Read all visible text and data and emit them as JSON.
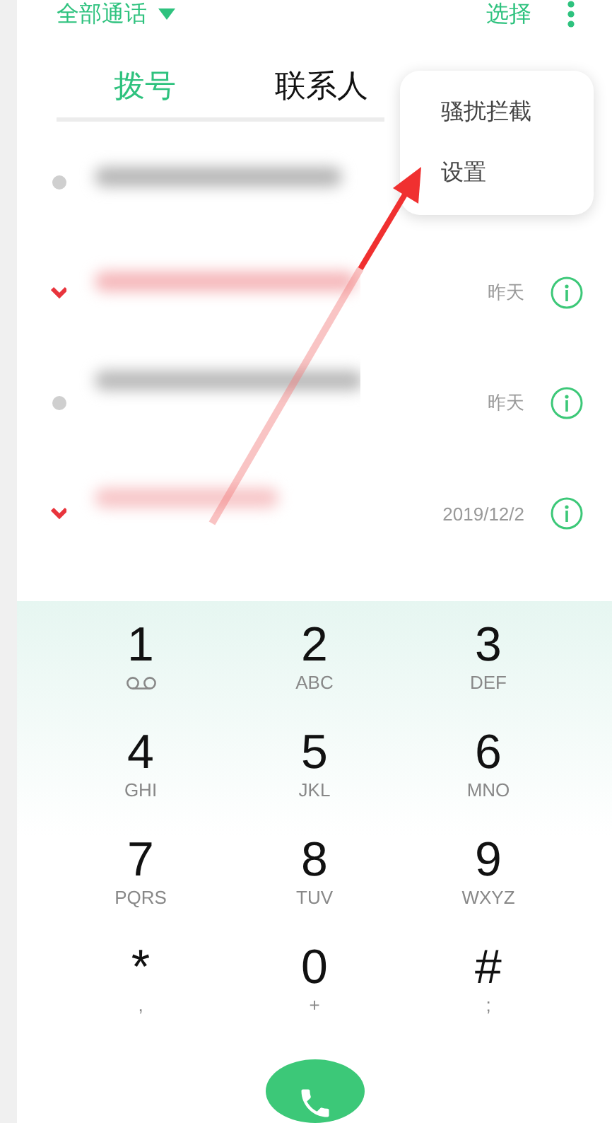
{
  "top_bar": {
    "filter": "全部通话",
    "select": "选择"
  },
  "tabs": [
    {
      "label": "拨号",
      "selected": true
    },
    {
      "label": "联系人",
      "selected": false
    }
  ],
  "menu": {
    "items": [
      "骚扰拦截",
      "设置"
    ]
  },
  "calls": [
    {
      "missed": false
    },
    {
      "missed": true,
      "time": "昨天"
    },
    {
      "missed": false,
      "time": "昨天"
    },
    {
      "missed": true,
      "time": "2019/12/2"
    }
  ],
  "dialpad": [
    {
      "digit": "1",
      "kind": "voicemail"
    },
    {
      "digit": "2",
      "kind": "letters",
      "sub": "ABC"
    },
    {
      "digit": "3",
      "kind": "letters",
      "sub": "DEF"
    },
    {
      "digit": "4",
      "kind": "letters",
      "sub": "GHI"
    },
    {
      "digit": "5",
      "kind": "letters",
      "sub": "JKL"
    },
    {
      "digit": "6",
      "kind": "letters",
      "sub": "MNO"
    },
    {
      "digit": "7",
      "kind": "letters",
      "sub": "PQRS"
    },
    {
      "digit": "8",
      "kind": "letters",
      "sub": "TUV"
    },
    {
      "digit": "9",
      "kind": "letters",
      "sub": "WXYZ"
    },
    {
      "digit": "*",
      "kind": "letters",
      "sub": ","
    },
    {
      "digit": "0",
      "kind": "letters",
      "sub": "+"
    },
    {
      "digit": "#",
      "kind": "letters",
      "sub": ";"
    }
  ]
}
